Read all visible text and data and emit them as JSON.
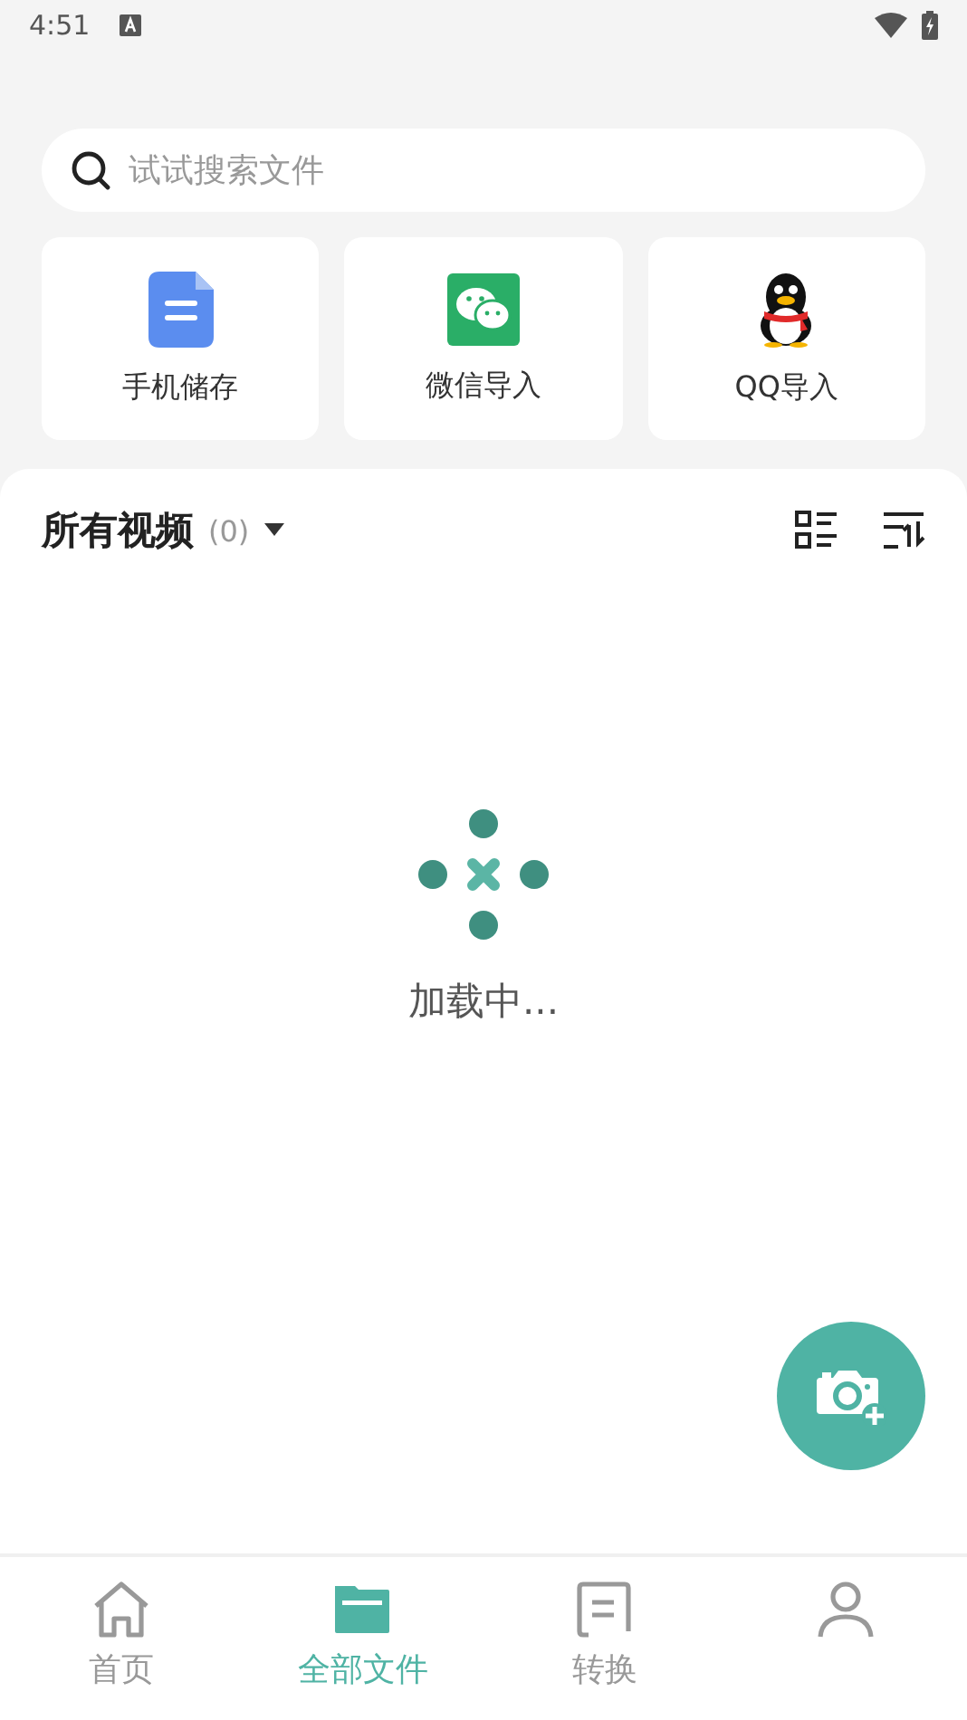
{
  "status_bar": {
    "time": "4:51"
  },
  "search": {
    "placeholder": "试试搜索文件"
  },
  "sources": [
    {
      "kind": "phone",
      "label": "手机储存"
    },
    {
      "kind": "wechat",
      "label": "微信导入"
    },
    {
      "kind": "qq",
      "label": "QQ导入"
    }
  ],
  "section": {
    "title": "所有视频",
    "count": "(0)"
  },
  "loading": {
    "text": "加载中..."
  },
  "tabs": [
    {
      "kind": "home",
      "label": "首页",
      "selected": false
    },
    {
      "kind": "folder",
      "label": "全部文件",
      "selected": true
    },
    {
      "kind": "convert",
      "label": "转换",
      "selected": false
    },
    {
      "kind": "person",
      "selected": false
    }
  ]
}
